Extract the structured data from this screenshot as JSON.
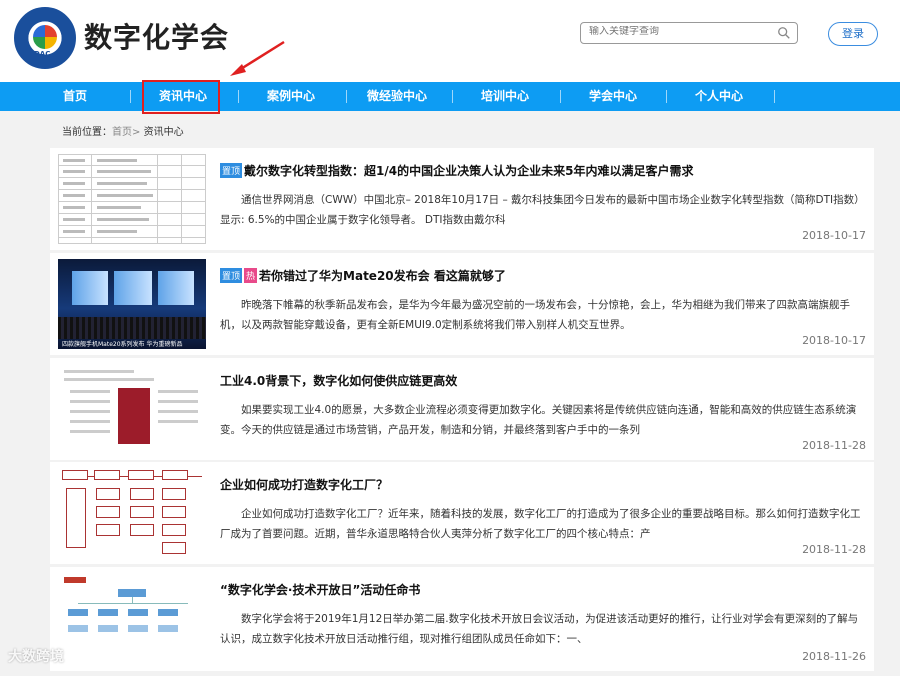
{
  "site": {
    "title": "数字化学会",
    "logo_text": "DAC"
  },
  "search": {
    "placeholder": "输入关键字查询"
  },
  "header": {
    "login_label": "登录"
  },
  "nav": {
    "items": [
      "首页",
      "资讯中心",
      "案例中心",
      "微经验中心",
      "培训中心",
      "学会中心",
      "个人中心"
    ],
    "active": "资讯中心"
  },
  "breadcrumb": {
    "label": "当前位置：",
    "home": "首页",
    "sep": ">",
    "current": "资讯中心"
  },
  "tags": {
    "top": "置顶",
    "hot": "热"
  },
  "articles": [
    {
      "title": "戴尔数字化转型指数：超1/4的中国企业决策人认为企业未来5年内难以满足客户需求",
      "summary": "通信世界网消息（CWW）中国北京– 2018年10月17日 – 戴尔科技集团今日发布的最新中国市场企业数字化转型指数（简称DTI指数）显示: 6.5%的中国企业属于数字化领导者。 DTI指数由戴尔科",
      "date": "2018-10-17"
    },
    {
      "title": "若你错过了华为Mate20发布会 看这篇就够了",
      "summary": "昨晚落下帷幕的秋季新品发布会，是华为今年最为盛况空前的一场发布会，十分惊艳，会上，华为相继为我们带来了四款高端旗舰手机，以及两款智能穿戴设备，更有全新EMUI9.0定制系统将我们带入别样人机交互世界。",
      "date": "2018-10-17",
      "thumb_caption": "四款旗舰手机Mate20系列发布 华为重磅新品"
    },
    {
      "title": "工业4.0背景下，数字化如何使供应链更高效",
      "summary": "如果要实现工业4.0的愿景，大多数企业流程必须变得更加数字化。关键因素将是传统供应链向连通，智能和高效的供应链生态系统演变。今天的供应链是通过市场营销，产品开发，制造和分销，并最终落到客户手中的一条列",
      "date": "2018-11-28"
    },
    {
      "title": "企业如何成功打造数字化工厂？",
      "summary": "企业如何成功打造数字化工厂？近年来，随着科技的发展，数字化工厂的打造成为了很多企业的重要战略目标。那么如何打造数字化工厂成为了首要问题。近期，普华永道思略特合伙人夷萍分析了数字化工厂的四个核心特点：产",
      "date": "2018-11-28"
    },
    {
      "title": "“数字化学会·技术开放日”活动任命书",
      "summary": "数字化学会将于2019年1月12日举办第二届.数字化技术开放日会议活动，为促进该活动更好的推行，让行业对学会有更深刻的了解与认识，成立数字化技术开放日活动推行组，现对推行组团队成员任命如下：一、",
      "date": "2018-11-26"
    }
  ],
  "watermark": "大数跨境",
  "colors": {
    "nav_bg": "#0d9cf3",
    "highlight": "#e02020",
    "tag_top": "#2e8de0",
    "tag_hot": "#e84a8a"
  }
}
